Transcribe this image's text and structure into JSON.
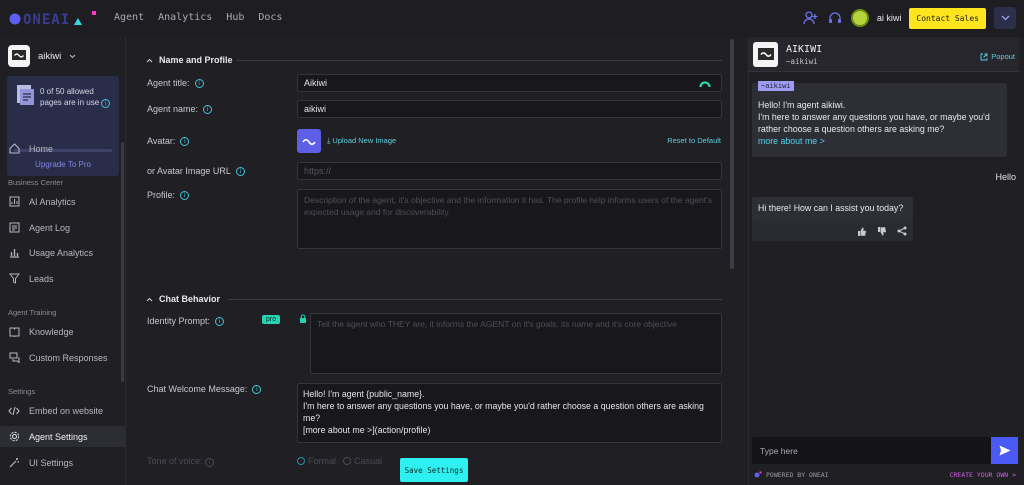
{
  "brand": {
    "logo_text": "ONEAI"
  },
  "topnav": {
    "items": [
      "Agent",
      "Analytics",
      "Hub",
      "Docs"
    ],
    "username": "ai kiwi",
    "contact_label": "Contact Sales"
  },
  "sidebar": {
    "agent_name": "aikiwi",
    "quota": {
      "text": "0 of 50 allowed pages are in use",
      "upgrade": "Upgrade To Pro",
      "used_fraction": 0.0
    },
    "home": "Home",
    "business_center": "Business Center",
    "bc_items": [
      "AI Analytics",
      "Agent Log",
      "Usage Analytics",
      "Leads"
    ],
    "agent_training": "Agent Training",
    "training_items": [
      "Knowledge",
      "Custom Responses"
    ],
    "settings": "Settings",
    "settings_items": [
      "Embed on website",
      "Agent Settings",
      "UI Settings"
    ]
  },
  "form": {
    "name_section": "Name and Profile",
    "agent_title_label": "Agent title:",
    "agent_title_value": "Aikiwi",
    "agent_name_label": "Agent name:",
    "agent_name_value": "aikiwi",
    "avatar_label": "Avatar:",
    "upload_label": "Upload New Image",
    "reset_label": "Reset to Default",
    "avatar_url_label": "or Avatar Image URL",
    "avatar_url_placeholder": "https://",
    "profile_label": "Profile:",
    "profile_placeholder": "Description of the agent, it's objective and the information it has. The profile help informs users of the agent's expected usage and for discoverability",
    "chat_section": "Chat Behavior",
    "identity_label": "Identity Prompt:",
    "pro_badge": "pro",
    "identity_placeholder": "Tell the agent who THEY are, it informs the AGENT on it's goals, its name and it's core objective",
    "welcome_label": "Chat Welcome Message:",
    "welcome_lines": [
      "Hello! I'm agent {public_name}.",
      "I'm here to answer any questions you have, or maybe you'd rather choose a question others are asking me?",
      "[more about me >](action/profile)"
    ],
    "tone_label": "Tone of voice:",
    "tone_options": [
      "Formal",
      "Casual"
    ],
    "save_label": "Save Settings"
  },
  "chat": {
    "title": "AIKIWI",
    "handle": "~aikiwi",
    "popout": "Popout",
    "tag": "~aikiwi",
    "bot_intro_lines": [
      "Hello! I'm agent aikiwi.",
      "I'm here to answer any questions you have, or maybe you'd rather choose a question others are asking me?"
    ],
    "more_link": "more about me >",
    "user_message": "Hello",
    "bot_reply": "Hi there! How can I assist you today?",
    "input_placeholder": "Type here",
    "powered_by": "POWERED BY ONEAI",
    "create_own": "CREATE YOUR OWN >"
  },
  "colors": {
    "accent_cyan": "#2ff0f0",
    "contact_yellow": "#ffe51d",
    "send_blue": "#4b59f5",
    "pro_green": "#26d3b2"
  }
}
